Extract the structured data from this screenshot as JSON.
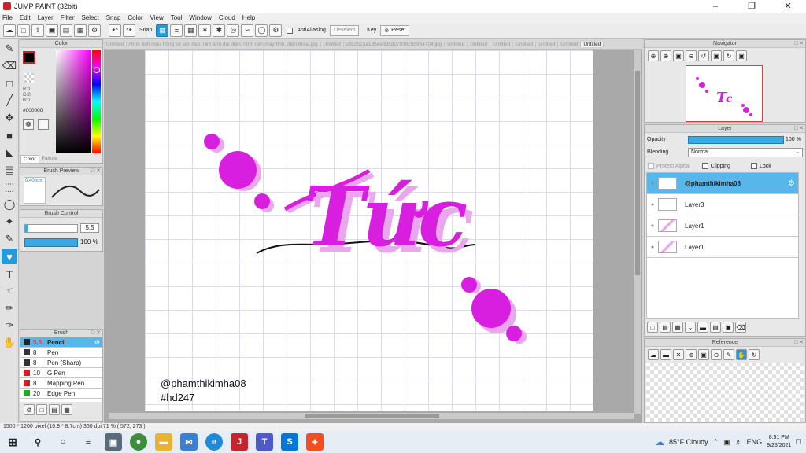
{
  "window": {
    "title": "JUMP PAINT (32bit)"
  },
  "menu": [
    "File",
    "Edit",
    "Layer",
    "Filter",
    "Select",
    "Snap",
    "Color",
    "View",
    "Tool",
    "Window",
    "Cloud",
    "Help"
  ],
  "toolbar": {
    "snap_label": "Snap",
    "antialias_label": "AntiAliasing",
    "deselect_label": "Deselect",
    "key_label": "Key",
    "reset_label": "Reset"
  },
  "tabs": [
    "Untitled",
    "Hình ảnh màu hồng kẻ sọc đẹp, làm ảnh đại diện, hình nền máy tính, điện thoại.jpg",
    "Untitled",
    "c8c2523a1d5eed95d27038c95984704.jpg",
    "Untitled",
    "Untitled",
    "Untitled",
    "Untitled",
    "untitled",
    "Untitled",
    "Untitled"
  ],
  "color_panel": {
    "title": "Color",
    "r": "R:0",
    "g": "G:0",
    "b": "B:0",
    "hex": "#000000",
    "tab1": "Color",
    "tab2": "Palette"
  },
  "brush_preview": {
    "title": "Brush Preview",
    "size": "0.40mm"
  },
  "brush_control": {
    "title": "Brush Control",
    "size_value": "5.5",
    "opacity_value": "100 %"
  },
  "brush_list": {
    "title": "Brush",
    "items": [
      {
        "size": "5.5",
        "name": "Pencil",
        "color": "#cc0000"
      },
      {
        "size": "8",
        "name": "Pen",
        "color": "#333333"
      },
      {
        "size": "8",
        "name": "Pen (Sharp)",
        "color": "#333333"
      },
      {
        "size": "10",
        "name": "G Pen",
        "color": "#cc2222"
      },
      {
        "size": "8",
        "name": "Mapping Pen",
        "color": "#cc2222"
      },
      {
        "size": "20",
        "name": "Edge Pen",
        "color": "#22aa22"
      }
    ]
  },
  "navigator": {
    "title": "Navigator"
  },
  "layer_panel": {
    "title": "Layer",
    "opacity_label": "Opacity",
    "opacity_value": "100 %",
    "blending_label": "Blending",
    "blending_value": "Normal",
    "protect_alpha": "Protect Alpha",
    "clipping": "Clipping",
    "lock": "Lock",
    "layers": [
      {
        "name": "@phamthikimha08"
      },
      {
        "name": "Layer3"
      },
      {
        "name": "Layer1"
      },
      {
        "name": "Layer1"
      }
    ]
  },
  "reference": {
    "title": "Reference"
  },
  "artwork": {
    "main_text": "Tức",
    "handle": "@phamthikimha08",
    "hashtag": "#hd247",
    "accent": "#d81fe0",
    "shadow": "#e9a8ee"
  },
  "status": {
    "text": "1500 * 1200 pixel   (10.9 * 8.7cm)   350 dpi   71 %   ( 572, 273 )"
  },
  "taskbar": {
    "weather": "85°F  Cloudy",
    "lang": "ENG",
    "time": "8:51 PM",
    "date": "9/28/2021"
  }
}
